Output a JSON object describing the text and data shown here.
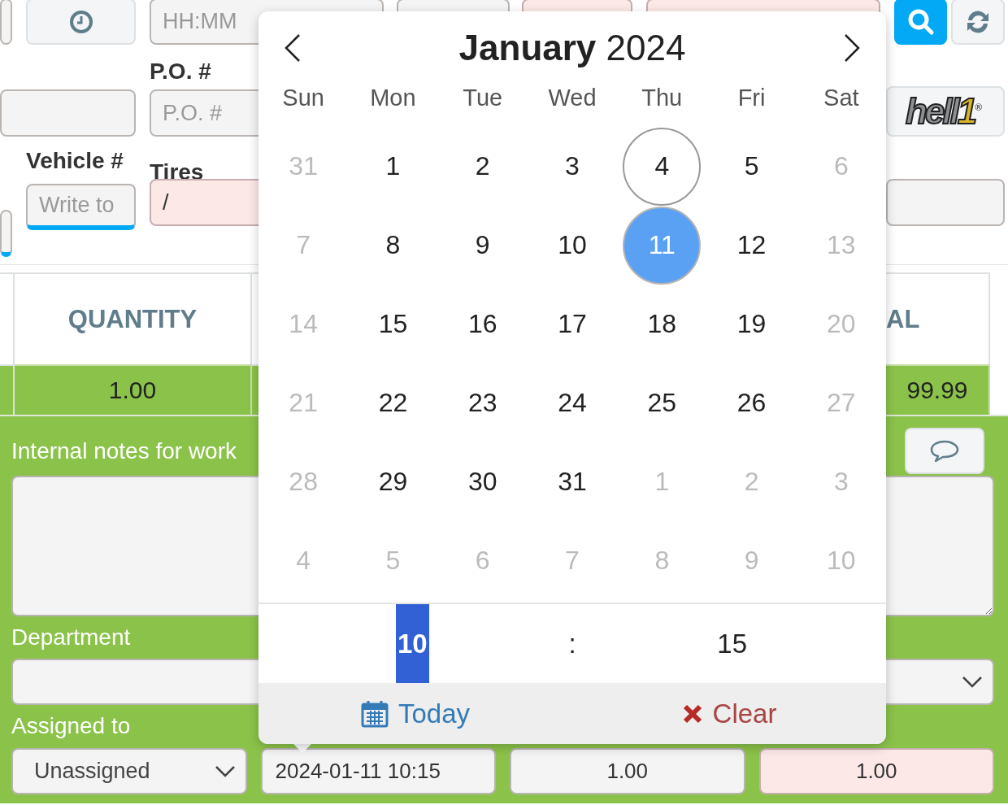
{
  "form": {
    "time": {
      "placeholder": "HH:MM"
    },
    "covered_fields": [
      {
        "invalid": false
      },
      {
        "invalid": true
      },
      {
        "invalid": true
      }
    ],
    "po": {
      "label": "P.O. #",
      "placeholder": "P.O. #"
    },
    "vehicle": {
      "label": "Vehicle #",
      "placeholder": "Write to",
      "underlined": true
    },
    "tires": {
      "label": "Tires",
      "value": "/",
      "invalid": true
    },
    "logo": {
      "word": "hell",
      "digit": "1",
      "mark": "®"
    }
  },
  "table": {
    "columns": [
      "QUANTITY",
      "AL"
    ],
    "rows": [
      [
        "1.00",
        "99.99"
      ]
    ]
  },
  "panel": {
    "notes_label": "Internal notes for work",
    "department_label": "Department",
    "assigned_label": "Assigned to",
    "assigned_value": "Unassigned",
    "fields": [
      {
        "value": "2024-01-11 10:15",
        "invalid": false,
        "kind": "date"
      },
      {
        "value": "1.00",
        "invalid": false,
        "kind": "number"
      },
      {
        "value": "1.00",
        "invalid": true,
        "kind": "number"
      }
    ]
  },
  "datepicker": {
    "month": "January",
    "year": "2024",
    "weekdays": [
      "Sun",
      "Mon",
      "Tue",
      "Wed",
      "Thu",
      "Fri",
      "Sat"
    ],
    "weeks": [
      [
        {
          "label": "31",
          "disabled": true,
          "today": false,
          "selected": false
        },
        {
          "label": "1",
          "disabled": false,
          "today": false,
          "selected": false
        },
        {
          "label": "2",
          "disabled": false,
          "today": false,
          "selected": false
        },
        {
          "label": "3",
          "disabled": false,
          "today": false,
          "selected": false
        },
        {
          "label": "4",
          "disabled": false,
          "today": true,
          "selected": false
        },
        {
          "label": "5",
          "disabled": false,
          "today": false,
          "selected": false
        },
        {
          "label": "6",
          "disabled": true,
          "today": false,
          "selected": false
        }
      ],
      [
        {
          "label": "7",
          "disabled": true,
          "today": false,
          "selected": false
        },
        {
          "label": "8",
          "disabled": false,
          "today": false,
          "selected": false
        },
        {
          "label": "9",
          "disabled": false,
          "today": false,
          "selected": false
        },
        {
          "label": "10",
          "disabled": false,
          "today": false,
          "selected": false
        },
        {
          "label": "11",
          "disabled": false,
          "today": false,
          "selected": true
        },
        {
          "label": "12",
          "disabled": false,
          "today": false,
          "selected": false
        },
        {
          "label": "13",
          "disabled": true,
          "today": false,
          "selected": false
        }
      ],
      [
        {
          "label": "14",
          "disabled": true,
          "today": false,
          "selected": false
        },
        {
          "label": "15",
          "disabled": false,
          "today": false,
          "selected": false
        },
        {
          "label": "16",
          "disabled": false,
          "today": false,
          "selected": false
        },
        {
          "label": "17",
          "disabled": false,
          "today": false,
          "selected": false
        },
        {
          "label": "18",
          "disabled": false,
          "today": false,
          "selected": false
        },
        {
          "label": "19",
          "disabled": false,
          "today": false,
          "selected": false
        },
        {
          "label": "20",
          "disabled": true,
          "today": false,
          "selected": false
        }
      ],
      [
        {
          "label": "21",
          "disabled": true,
          "today": false,
          "selected": false
        },
        {
          "label": "22",
          "disabled": false,
          "today": false,
          "selected": false
        },
        {
          "label": "23",
          "disabled": false,
          "today": false,
          "selected": false
        },
        {
          "label": "24",
          "disabled": false,
          "today": false,
          "selected": false
        },
        {
          "label": "25",
          "disabled": false,
          "today": false,
          "selected": false
        },
        {
          "label": "26",
          "disabled": false,
          "today": false,
          "selected": false
        },
        {
          "label": "27",
          "disabled": true,
          "today": false,
          "selected": false
        }
      ],
      [
        {
          "label": "28",
          "disabled": true,
          "today": false,
          "selected": false
        },
        {
          "label": "29",
          "disabled": false,
          "today": false,
          "selected": false
        },
        {
          "label": "30",
          "disabled": false,
          "today": false,
          "selected": false
        },
        {
          "label": "31",
          "disabled": false,
          "today": false,
          "selected": false
        },
        {
          "label": "1",
          "disabled": true,
          "today": false,
          "selected": false
        },
        {
          "label": "2",
          "disabled": true,
          "today": false,
          "selected": false
        },
        {
          "label": "3",
          "disabled": true,
          "today": false,
          "selected": false
        }
      ],
      [
        {
          "label": "4",
          "disabled": true,
          "today": false,
          "selected": false
        },
        {
          "label": "5",
          "disabled": true,
          "today": false,
          "selected": false
        },
        {
          "label": "6",
          "disabled": true,
          "today": false,
          "selected": false
        },
        {
          "label": "7",
          "disabled": true,
          "today": false,
          "selected": false
        },
        {
          "label": "8",
          "disabled": true,
          "today": false,
          "selected": false
        },
        {
          "label": "9",
          "disabled": true,
          "today": false,
          "selected": false
        },
        {
          "label": "10",
          "disabled": true,
          "today": false,
          "selected": false
        }
      ]
    ],
    "time": {
      "hour": "10",
      "separator": ":",
      "minute": "15",
      "hour_selected": true
    },
    "today_label": "Today",
    "clear_label": "Clear"
  }
}
